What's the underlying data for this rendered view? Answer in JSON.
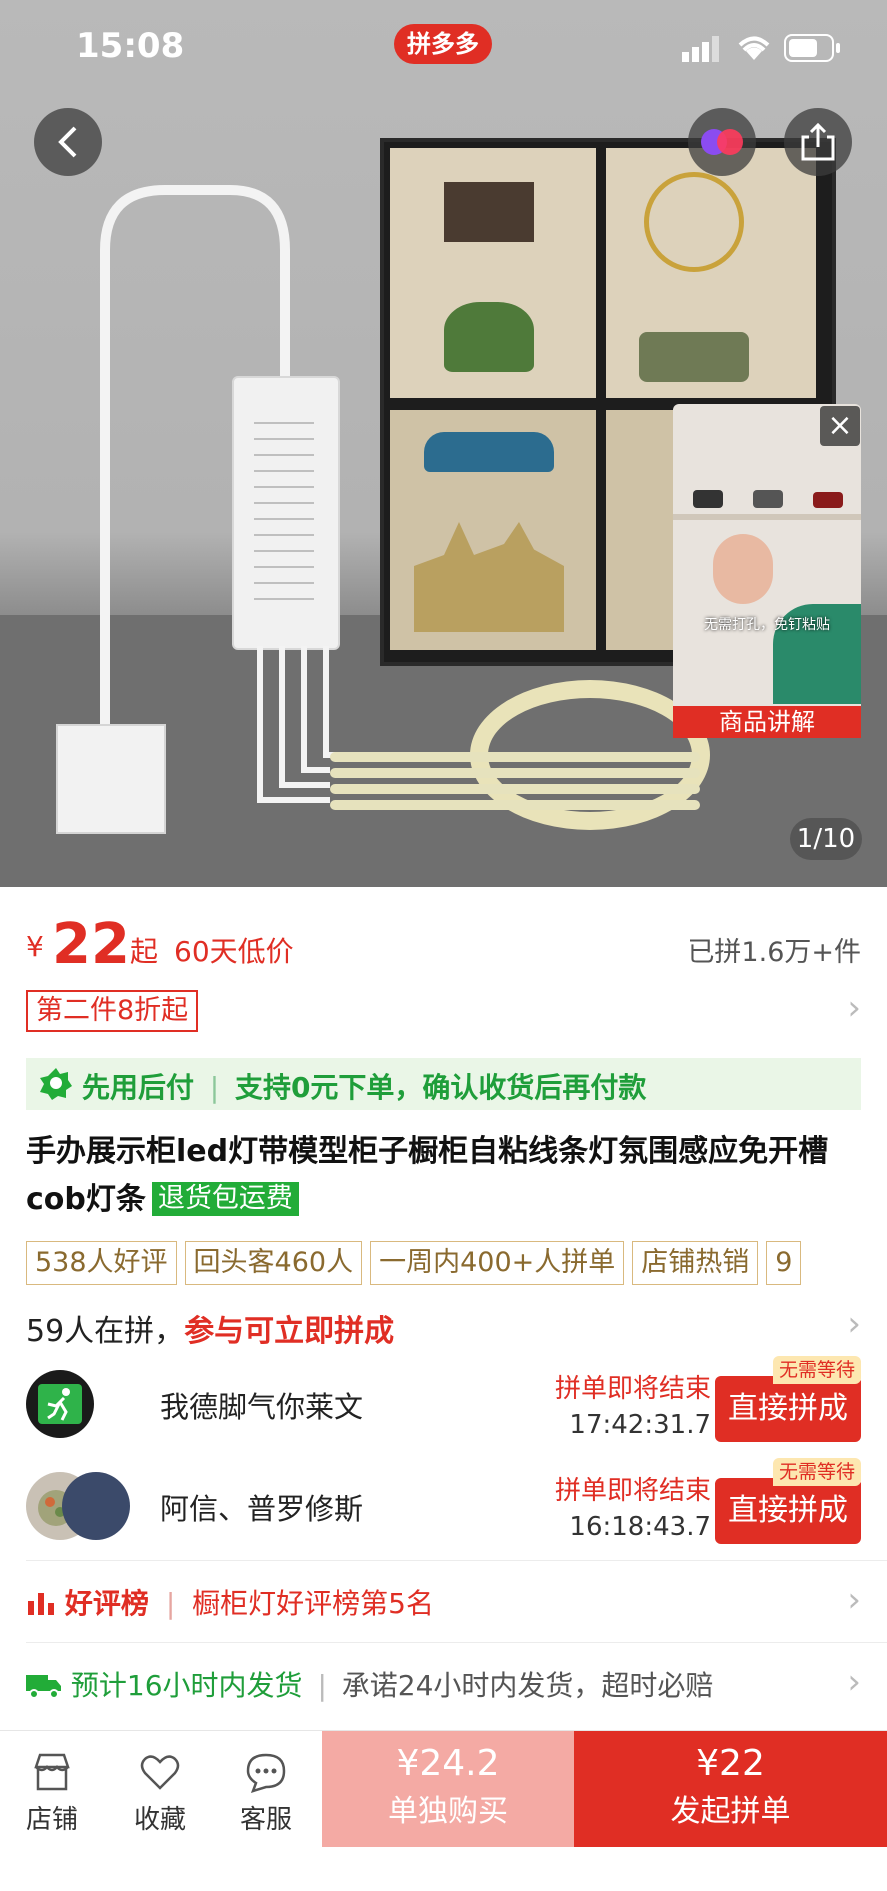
{
  "status_bar": {
    "time": "15:08",
    "app_badge": "拼多多"
  },
  "gallery": {
    "video_label": "商品讲解",
    "video_caption": "无需打孔，免钉粘贴",
    "counter": "1/10"
  },
  "price": {
    "currency": "¥",
    "amount": "22",
    "suffix": "起",
    "note": "60天低价",
    "sold": "已拼1.6万+件"
  },
  "promo": {
    "discount": "第二件8折起"
  },
  "pay_later": {
    "label": "先用后付",
    "separator": "|",
    "text": "支持0元下单，确认收货后再付款"
  },
  "product": {
    "title": "手办展示柜led灯带模型柜子橱柜自粘线条灯氛围感应免开槽cob灯条",
    "return_badge": "退货包运费"
  },
  "tags": [
    "538人好评",
    "回头客460人",
    "一周内400+人拼单",
    "店铺热销",
    "9"
  ],
  "group": {
    "count_text": "59人在拼，",
    "cta_text": "参与可立即拼成",
    "rows": [
      {
        "name": "我德脚气你莱文",
        "status": "拼单即将结束",
        "countdown": "17:42:31.7",
        "badge": "无需等待",
        "button": "直接拼成"
      },
      {
        "name": "阿信、普罗修斯",
        "status": "拼单即将结束",
        "countdown": "16:18:43.7",
        "badge": "无需等待",
        "button": "直接拼成"
      }
    ]
  },
  "ranking": {
    "label": "好评榜",
    "text": "橱柜灯好评榜第5名"
  },
  "shipping": {
    "label": "预计16小时内发货",
    "text": "承诺24小时内发货，超时必赔"
  },
  "bottom_bar": {
    "shop": "店铺",
    "favorite": "收藏",
    "service": "客服",
    "solo_price": "¥24.2",
    "solo_label": "单独购买",
    "group_price": "¥22",
    "group_label": "发起拼单"
  },
  "colors": {
    "brand_red": "#e02e24",
    "green": "#22ac38",
    "pale_red": "#f4aaa4"
  }
}
